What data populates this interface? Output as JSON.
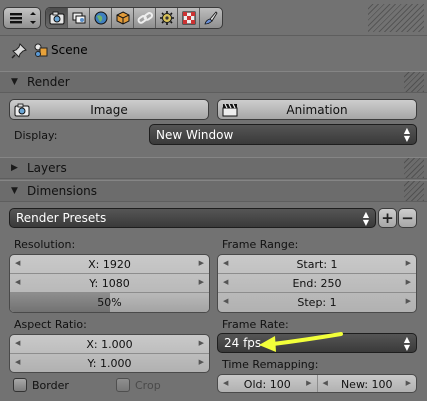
{
  "header": {
    "editor_icon": "properties-editor-icon",
    "context_tabs": [
      {
        "icon": "render-camera-icon",
        "active": true
      },
      {
        "icon": "render-layers-icon",
        "active": false
      },
      {
        "icon": "world-icon",
        "active": false
      },
      {
        "icon": "object-cube-icon",
        "active": false
      },
      {
        "icon": "constraints-chain-icon",
        "active": false
      },
      {
        "icon": "modifier-gear-icon",
        "active": false
      },
      {
        "icon": "texture-checker-icon",
        "active": false
      },
      {
        "icon": "brush-icon",
        "active": false
      }
    ]
  },
  "path": {
    "label": "Scene",
    "pin_icon": "pin-icon",
    "scene_icon": "scene-icon"
  },
  "render_panel": {
    "title": "Render",
    "image_label": "Image",
    "animation_label": "Animation",
    "display_label": "Display:",
    "display_value": "New Window"
  },
  "layers_panel": {
    "title": "Layers"
  },
  "dimensions_panel": {
    "title": "Dimensions",
    "presets_label": "Render Presets",
    "resolution_label": "Resolution:",
    "res_x": "X: 1920",
    "res_y": "Y: 1080",
    "res_percent": "50%",
    "res_percent_value": 0.5,
    "aspect_label": "Aspect Ratio:",
    "aspect_x": "X: 1.000",
    "aspect_y": "Y: 1.000",
    "border_label": "Border",
    "crop_label": "Crop",
    "frame_range_label": "Frame Range:",
    "start": "Start: 1",
    "end": "End: 250",
    "step": "Step: 1",
    "frame_rate_label": "Frame Rate:",
    "fps_value": "24 fps",
    "time_remap_label": "Time Remapping:",
    "old": "Old: 100",
    "new": "New: 100"
  },
  "colors": {
    "highlight_arrow": "#f2ff3a"
  }
}
